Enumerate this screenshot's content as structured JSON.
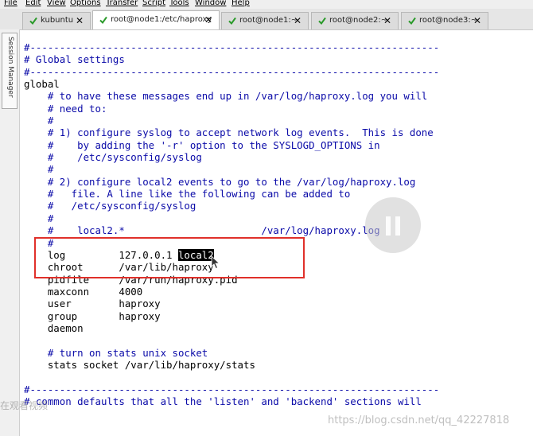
{
  "menu": [
    "File",
    "Edit",
    "View",
    "Options",
    "Transfer",
    "Script",
    "Tools",
    "Window",
    "Help"
  ],
  "tabs": [
    {
      "label": "kubuntu",
      "active": false
    },
    {
      "label": "root@node1:/etc/haproxy",
      "active": true
    },
    {
      "label": "root@node1:~",
      "active": false
    },
    {
      "label": "root@node2:~",
      "active": false
    },
    {
      "label": "root@node3:~",
      "active": false
    }
  ],
  "sidebar": {
    "label": "Session Manager"
  },
  "terminal": {
    "lines": [
      "#---------------------------------------------------------------------",
      "# Global settings",
      "#---------------------------------------------------------------------",
      "global",
      "    # to have these messages end up in /var/log/haproxy.log you will",
      "    # need to:",
      "    #",
      "    # 1) configure syslog to accept network log events.  This is done",
      "    #    by adding the '-r' option to the SYSLOGD_OPTIONS in",
      "    #    /etc/sysconfig/syslog",
      "    #",
      "    # 2) configure local2 events to go to the /var/log/haproxy.log",
      "    #   file. A line like the following can be added to",
      "    #   /etc/sysconfig/syslog",
      "    #",
      "    #    local2.*                       /var/log/haproxy.log",
      "    #",
      "    log         127.0.0.1 ",
      "    chroot      /var/lib/haproxy",
      "    pidfile     /var/run/haproxy.pid",
      "    maxconn     4000",
      "    user        haproxy",
      "    group       haproxy",
      "    daemon",
      "",
      "    # turn on stats unix socket",
      "    stats socket /var/lib/haproxy/stats",
      "",
      "#---------------------------------------------------------------------",
      "# common defaults that all the 'listen' and 'backend' sections will"
    ],
    "selected_text": "local2",
    "comment_color": "#0a0aa8"
  },
  "watermark": {
    "left": "在观看视频",
    "right": "https://blog.csdn.net/qq_42227818"
  }
}
